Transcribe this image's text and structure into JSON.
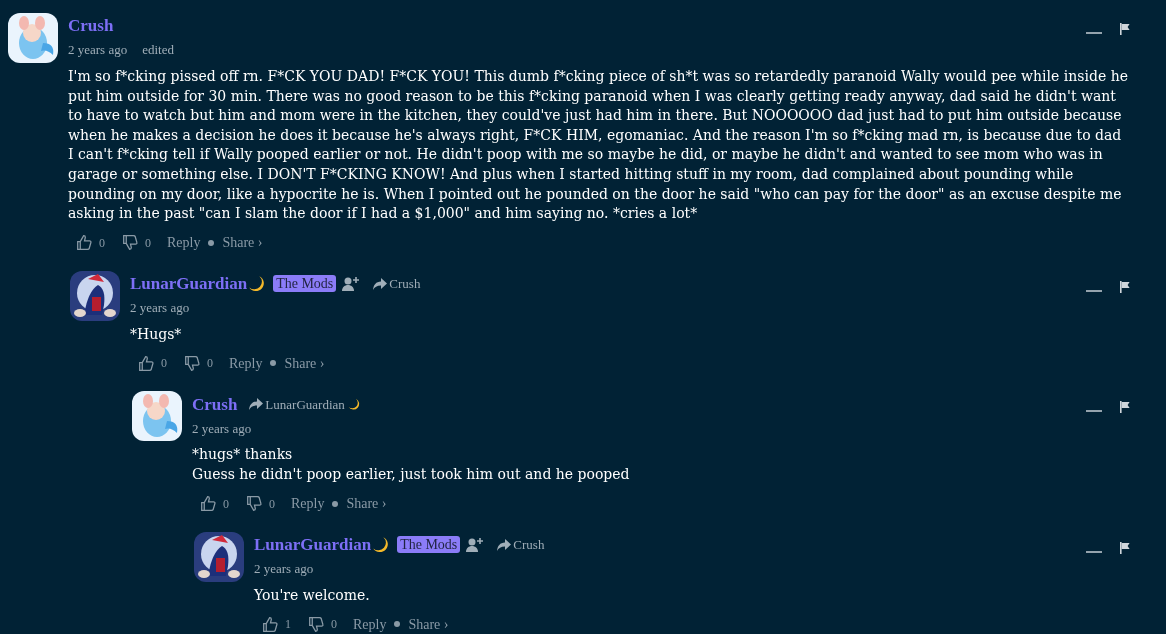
{
  "comments": [
    {
      "author": "Crush",
      "moon": false,
      "kind": "crush",
      "follow": false,
      "time": "2 years ago",
      "edited": "edited",
      "body": [
        "I'm so f*cking pissed off rn. F*CK YOU DAD! F*CK YOU! This dumb f*cking piece of sh*t was so retardedly paranoid Wally would pee while inside he put him outside for 30 min. There was no good reason to be this f*cking paranoid when I was clearly getting ready anyway, dad said he didn't want to have to watch but him and mom were in the kitchen, they could've just had him in there. But NOOOOOO dad just had to put him outside because when he makes a decision he does it because he's always right, F*CK HIM, egomaniac. And the reason I'm so f*cking mad rn, is because due to dad I can't f*cking tell if Wally pooped earlier or not. He didn't poop with me so maybe he did, or maybe he didn't and wanted to see mom who was in garage or something else. I DON'T F*CKING KNOW! And plus when I started hitting stuff in my room, dad complained about pounding while pounding on my door, like a hypocrite he is. When I pointed out he pounded on the door he said \"who can pay for the door\" as an excuse despite me asking in the past \"can I slam the door if I had a $1,000\" and him saying no. *cries a lot*"
      ],
      "likes": "0",
      "dislikes": "0",
      "reply": "Reply",
      "share": "Share ›",
      "children": [
        {
          "author": "LunarGuardian",
          "moon": true,
          "kind": "lunar",
          "badge": "The Mods",
          "follow": true,
          "reply_to": {
            "name": "Crush",
            "moon": false
          },
          "time": "2 years ago",
          "body": [
            "*Hugs*"
          ],
          "likes": "0",
          "dislikes": "0",
          "reply": "Reply",
          "share": "Share ›",
          "children": [
            {
              "author": "Crush",
              "moon": false,
              "kind": "crush",
              "follow": false,
              "reply_to": {
                "name": "LunarGuardian",
                "moon": true
              },
              "time": "2 years ago",
              "body": [
                "*hugs* thanks",
                "Guess he didn't poop earlier, just took him out and he pooped"
              ],
              "likes": "0",
              "dislikes": "0",
              "reply": "Reply",
              "share": "Share ›",
              "children": [
                {
                  "author": "LunarGuardian",
                  "moon": true,
                  "kind": "lunar",
                  "badge": "The Mods",
                  "follow": true,
                  "reply_to": {
                    "name": "Crush",
                    "moon": false
                  },
                  "time": "2 years ago",
                  "body": [
                    "You're welcome."
                  ],
                  "likes": "1",
                  "dislikes": "0",
                  "reply": "Reply",
                  "share": "Share ›"
                }
              ]
            }
          ]
        }
      ]
    }
  ]
}
